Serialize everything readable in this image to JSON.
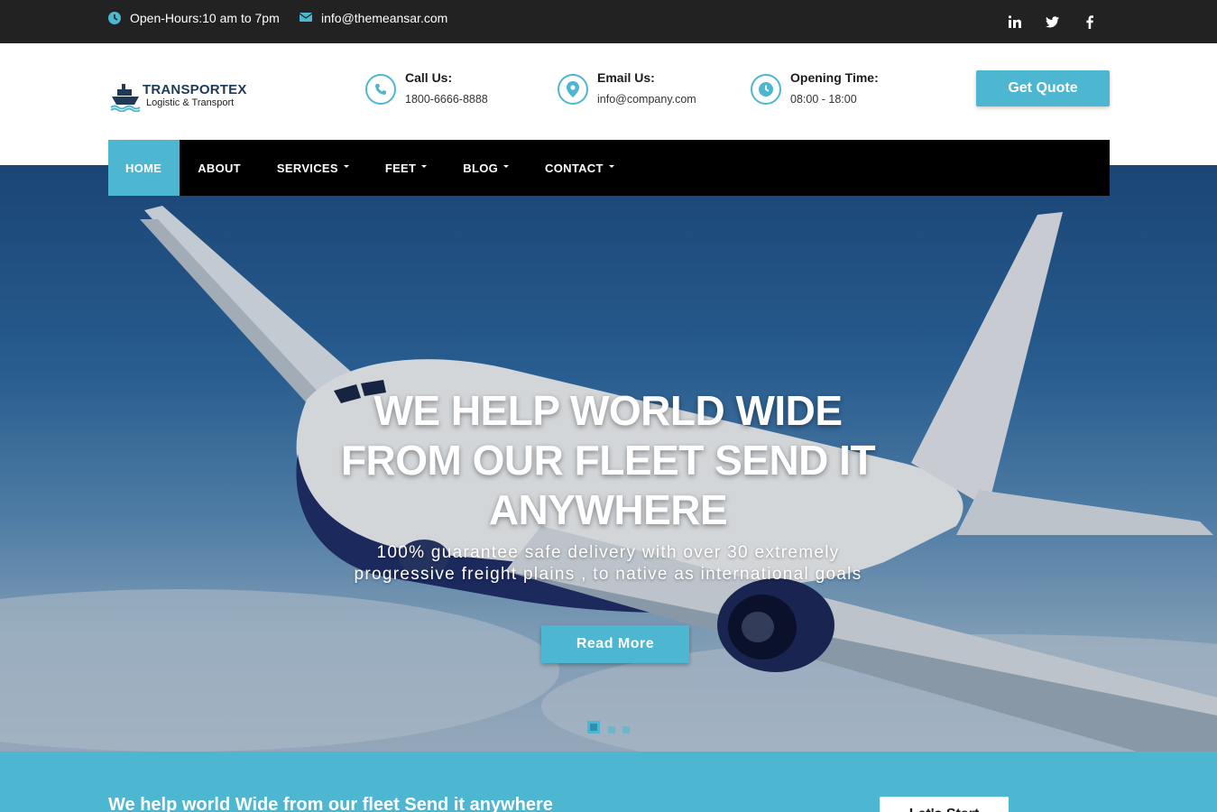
{
  "topbar": {
    "hours": "Open-Hours:10 am to 7pm",
    "email": "info@themeansar.com",
    "social": [
      "linkedin-icon",
      "twitter-icon",
      "facebook-icon"
    ]
  },
  "header": {
    "logo": {
      "name": "TRANSPORTEX",
      "tagline": "Logistic & Transport"
    },
    "call": {
      "title": "Call Us:",
      "value": "1800-6666-8888"
    },
    "email": {
      "title": "Email Us:",
      "value": "info@company.com"
    },
    "opening": {
      "title": "Opening Time:",
      "value": "08:00 - 18:00"
    },
    "quote_label": "Get Quote"
  },
  "nav": {
    "items": [
      {
        "label": "HOME",
        "active": true,
        "dropdown": false
      },
      {
        "label": "ABOUT",
        "active": false,
        "dropdown": false
      },
      {
        "label": "SERVICES",
        "active": false,
        "dropdown": true
      },
      {
        "label": "FEET",
        "active": false,
        "dropdown": true
      },
      {
        "label": "BLOG",
        "active": false,
        "dropdown": true
      },
      {
        "label": "CONTACT",
        "active": false,
        "dropdown": true
      }
    ]
  },
  "hero": {
    "title": "WE HELP WORLD WIDE FROM OUR FLEET SEND IT ANYWHERE",
    "subtitle": "100% guarantee safe delivery with over 30 extremely progressive freight plains , to native as international goals",
    "button_label": "Read More",
    "slides_count": 3,
    "active_slide": 1
  },
  "strip": {
    "title": "We help world Wide from our fleet Send it anywhere",
    "button_label": "Let's Start"
  },
  "colors": {
    "accent": "#4db6d1",
    "topbar_bg": "#222222",
    "nav_bg": "#000000"
  }
}
